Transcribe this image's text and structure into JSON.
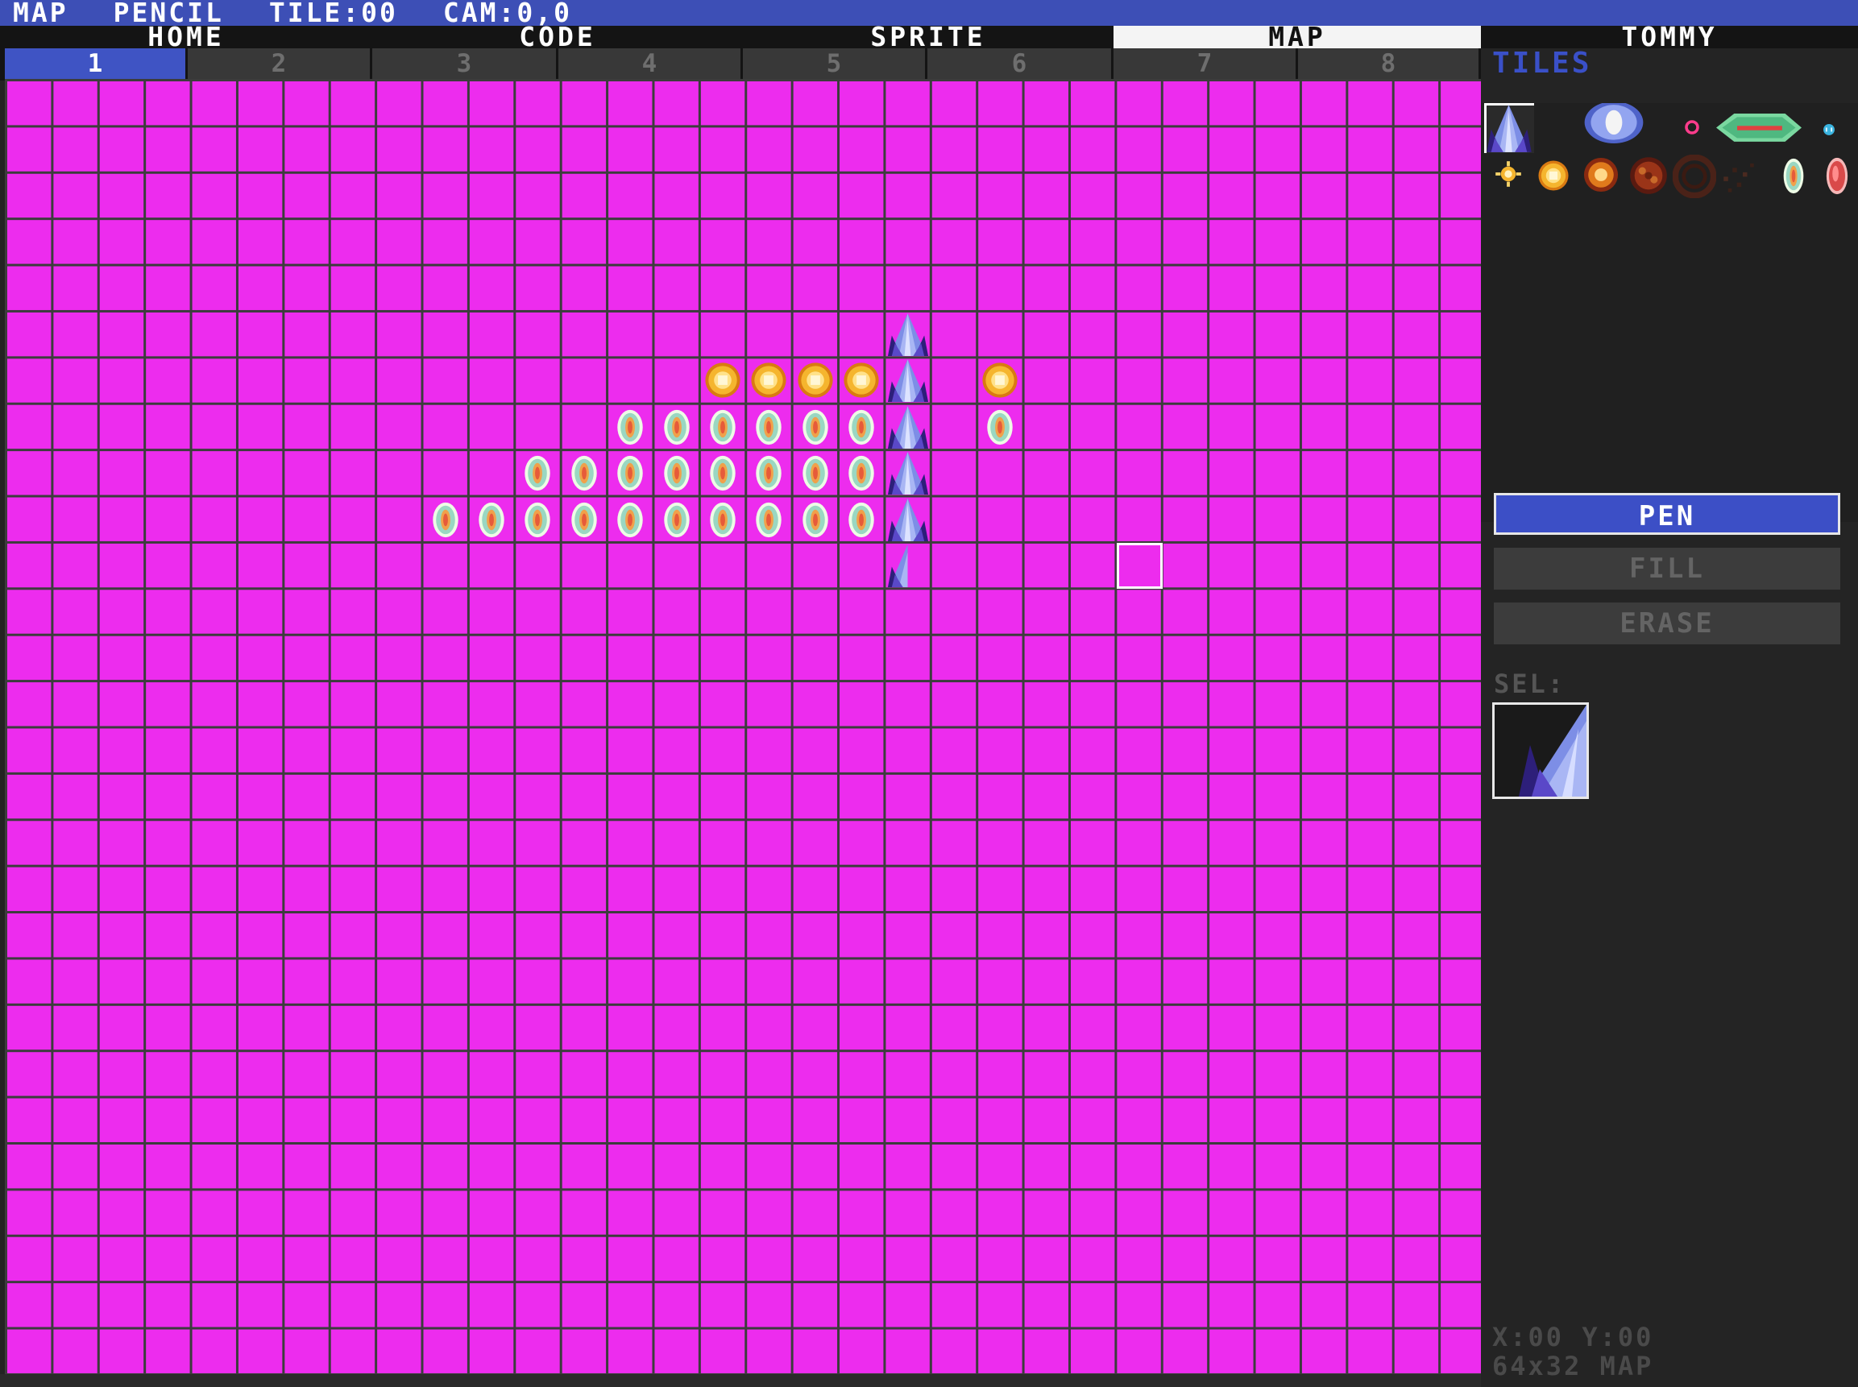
{
  "statusbar": {
    "mode": "MAP",
    "tool": "PENCIL",
    "tile": "TILE:00",
    "cam": "CAM:0,0"
  },
  "main_tabs": [
    {
      "label": "HOME",
      "active": false
    },
    {
      "label": "CODE",
      "active": false
    },
    {
      "label": "SPRITE",
      "active": false
    },
    {
      "label": "MAP",
      "active": true
    },
    {
      "label": "TOMMY",
      "active": false
    }
  ],
  "page_tabs": [
    {
      "label": "1",
      "active": true
    },
    {
      "label": "2",
      "active": false
    },
    {
      "label": "3",
      "active": false
    },
    {
      "label": "4",
      "active": false
    },
    {
      "label": "5",
      "active": false
    },
    {
      "label": "6",
      "active": false
    },
    {
      "label": "7",
      "active": false
    },
    {
      "label": "8",
      "active": false
    }
  ],
  "sidebar": {
    "tiles_title": "TILES",
    "tools": {
      "pen": "PEN",
      "fill": "FILL",
      "erase": "ERASE",
      "active": "pen"
    },
    "sel_label": "SEL:",
    "coords": "X:00 Y:00",
    "map_size": "64x32 MAP"
  },
  "map": {
    "columns": 32,
    "rows": 28,
    "background": "#ed2cee",
    "grid_color": "#3c3c3c",
    "hover_cell": {
      "col": 24,
      "row": 10
    },
    "placed_tiles": [
      {
        "type": "ship",
        "col": 19,
        "row": 5
      },
      {
        "type": "ship",
        "col": 19,
        "row": 6
      },
      {
        "type": "ship",
        "col": 19,
        "row": 7
      },
      {
        "type": "ship",
        "col": 19,
        "row": 8
      },
      {
        "type": "ship",
        "col": 19,
        "row": 9
      },
      {
        "type": "ship-half",
        "col": 19,
        "row": 10
      },
      {
        "type": "coin",
        "col": 15,
        "row": 6
      },
      {
        "type": "coin",
        "col": 16,
        "row": 6
      },
      {
        "type": "coin",
        "col": 17,
        "row": 6
      },
      {
        "type": "coin",
        "col": 18,
        "row": 6
      },
      {
        "type": "coin",
        "col": 21,
        "row": 6
      },
      {
        "type": "gem",
        "col": 13,
        "row": 7
      },
      {
        "type": "gem",
        "col": 14,
        "row": 7
      },
      {
        "type": "gem",
        "col": 15,
        "row": 7
      },
      {
        "type": "gem",
        "col": 16,
        "row": 7
      },
      {
        "type": "gem",
        "col": 17,
        "row": 7
      },
      {
        "type": "gem",
        "col": 18,
        "row": 7
      },
      {
        "type": "gem",
        "col": 21,
        "row": 7
      },
      {
        "type": "gem",
        "col": 11,
        "row": 8
      },
      {
        "type": "gem",
        "col": 12,
        "row": 8
      },
      {
        "type": "gem",
        "col": 13,
        "row": 8
      },
      {
        "type": "gem",
        "col": 14,
        "row": 8
      },
      {
        "type": "gem",
        "col": 15,
        "row": 8
      },
      {
        "type": "gem",
        "col": 16,
        "row": 8
      },
      {
        "type": "gem",
        "col": 17,
        "row": 8
      },
      {
        "type": "gem",
        "col": 18,
        "row": 8
      },
      {
        "type": "gem",
        "col": 9,
        "row": 9
      },
      {
        "type": "gem",
        "col": 10,
        "row": 9
      },
      {
        "type": "gem",
        "col": 11,
        "row": 9
      },
      {
        "type": "gem",
        "col": 12,
        "row": 9
      },
      {
        "type": "gem",
        "col": 13,
        "row": 9
      },
      {
        "type": "gem",
        "col": 14,
        "row": 9
      },
      {
        "type": "gem",
        "col": 15,
        "row": 9
      },
      {
        "type": "gem",
        "col": 16,
        "row": 9
      },
      {
        "type": "gem",
        "col": 17,
        "row": 9
      },
      {
        "type": "gem",
        "col": 18,
        "row": 9
      }
    ]
  },
  "palette_tiles": [
    {
      "type": "ship",
      "selected": true
    },
    {
      "type": "shield-pod"
    },
    {
      "type": "ring"
    },
    {
      "type": "green-saucer"
    },
    {
      "type": "mini-drone"
    },
    {
      "type": "spark"
    },
    {
      "type": "coin"
    },
    {
      "type": "explosion-1"
    },
    {
      "type": "explosion-2"
    },
    {
      "type": "explosion-3"
    },
    {
      "type": "debris"
    },
    {
      "type": "gem"
    },
    {
      "type": "red-gem"
    }
  ]
}
